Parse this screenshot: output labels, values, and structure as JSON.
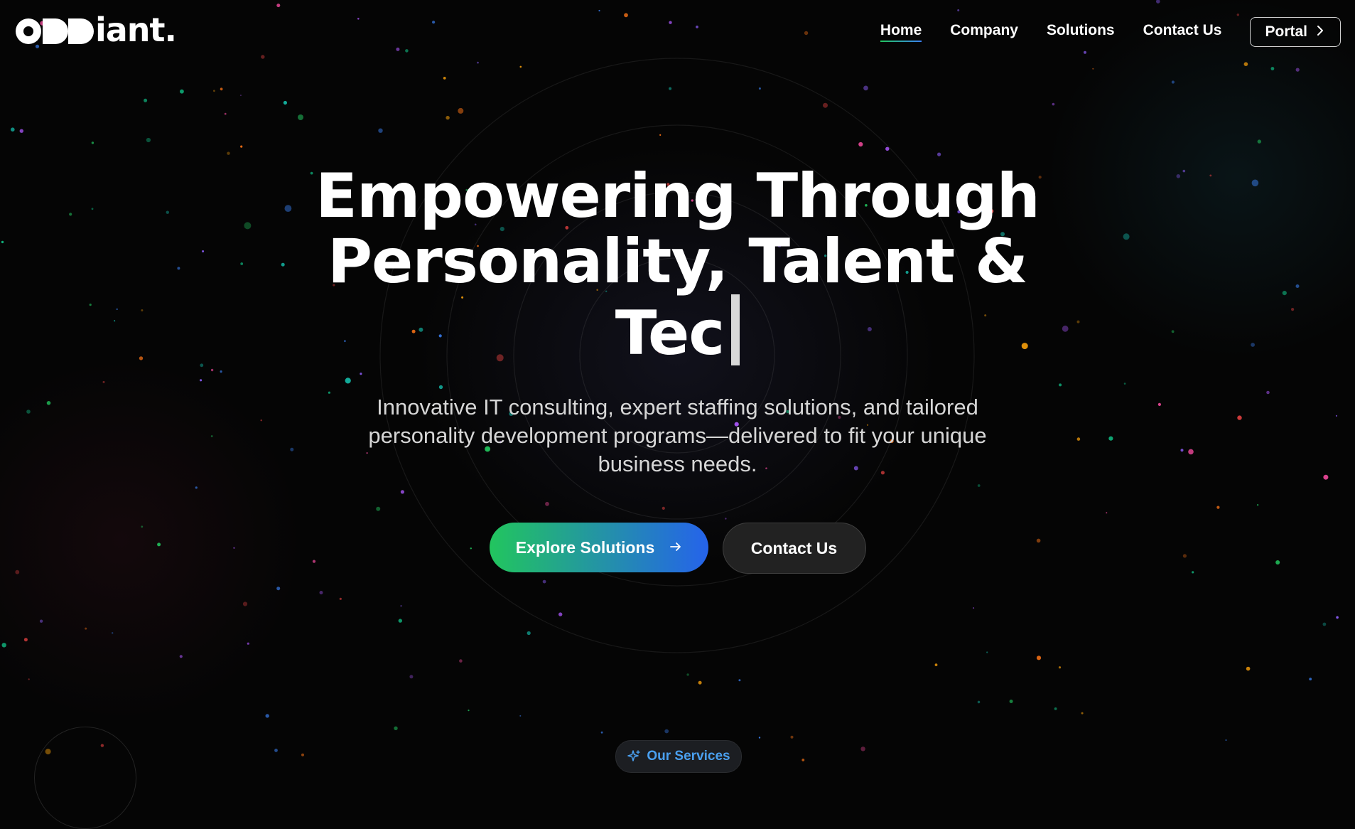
{
  "brand": {
    "logo_text": "iant.",
    "logo_mark": "odd-logo-mark"
  },
  "nav": {
    "items": [
      {
        "label": "Home",
        "active": true
      },
      {
        "label": "Company",
        "active": false
      },
      {
        "label": "Solutions",
        "active": false
      },
      {
        "label": "Contact Us",
        "active": false
      }
    ],
    "portal_label": "Portal",
    "portal_icon": "chevron-right-icon"
  },
  "hero": {
    "title_line1": "Empowering Through",
    "title_line2": "Personality, Talent &",
    "title_line3": "Tec",
    "subtitle": "Innovative IT consulting, expert staffing solutions, and tailored personality development programs—delivered to fit your unique business needs.",
    "primary_cta": "Explore Solutions",
    "primary_cta_icon": "arrow-right-icon",
    "secondary_cta": "Contact Us"
  },
  "services_badge": {
    "label": "Our Services",
    "icon": "sparkle-icon"
  },
  "colors": {
    "background": "#050505",
    "gradient_start": "#22c55e",
    "gradient_end": "#2563eb",
    "badge_text": "#4aa0f0"
  }
}
